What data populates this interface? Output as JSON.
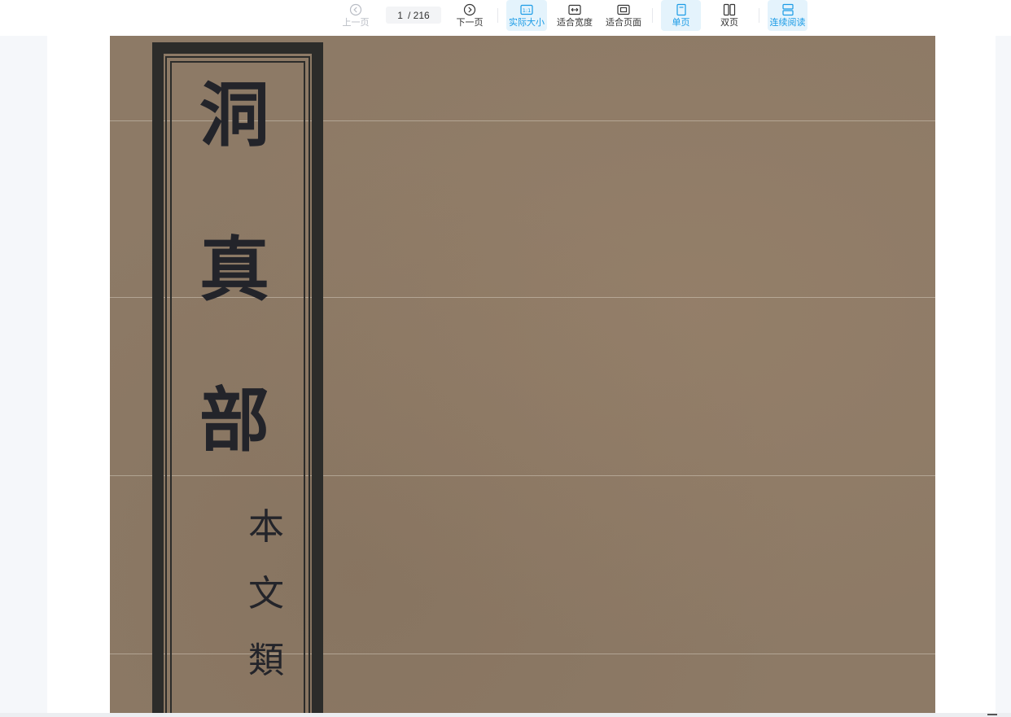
{
  "toolbar": {
    "prev_label": "上一页",
    "next_label": "下一页",
    "page_current": "1",
    "page_total": "/ 216",
    "actual_size_label": "实际大小",
    "fit_width_label": "适合宽度",
    "fit_page_label": "适合页面",
    "single_page_label": "单页",
    "double_page_label": "双页",
    "continuous_label": "连续阅读",
    "accent_color": "#1a9be6"
  },
  "document": {
    "title_chars": [
      "洞",
      "真",
      "部"
    ],
    "subtitle_chars": [
      "本",
      "文",
      "類"
    ]
  }
}
